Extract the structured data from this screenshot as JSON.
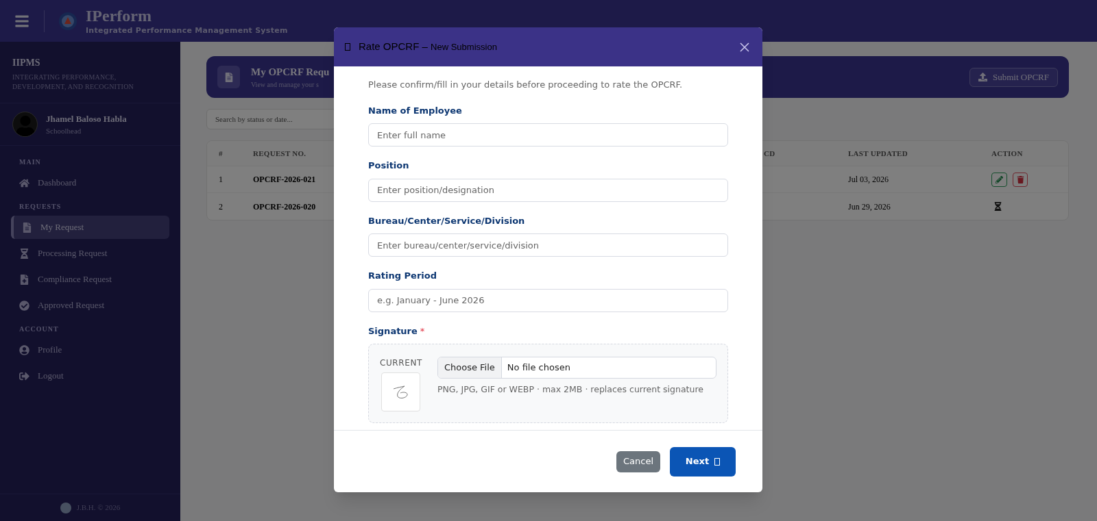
{
  "app_header": {
    "title": "IPerform",
    "subtitle": "Integrated Performance Management System"
  },
  "sidebar": {
    "brand": "IIPMS",
    "tagline": "INTEGRATING PERFORMANCE, DEVELOPMENT, AND RECOGNITION",
    "user": {
      "name": "Jhamel Baloso Habla",
      "role": "Schoolhead"
    },
    "sections": [
      {
        "title": "MAIN",
        "items": [
          {
            "label": "Dashboard",
            "selected": false
          }
        ]
      },
      {
        "title": "REQUESTS",
        "items": [
          {
            "label": "My Request",
            "selected": true
          },
          {
            "label": "Processing Request",
            "selected": false
          },
          {
            "label": "Compliance Request",
            "selected": false
          },
          {
            "label": "Approved Request",
            "selected": false
          }
        ]
      },
      {
        "title": "ACCOUNT",
        "items": [
          {
            "label": "Profile",
            "selected": false
          },
          {
            "label": "Logout",
            "selected": false
          }
        ]
      }
    ],
    "footer": "J.B.H. © 2026"
  },
  "page_header": {
    "title": "My OPCRF Requ",
    "subtitle": "View and manage your s",
    "button": "Submit OPCRF"
  },
  "search": {
    "placeholder": "Search by status or date..."
  },
  "table": {
    "columns": [
      "#",
      "REQUEST NO.",
      "CD",
      "LAST UPDATED",
      "ACTION"
    ],
    "rows": [
      {
        "number": "1",
        "request_no": "OPCRF-2026-021",
        "last_updated": "Jul 03, 2026",
        "kind": "editable"
      },
      {
        "number": "2",
        "request_no": "OPCRF-2026-020",
        "last_updated": "Jun 29, 2026",
        "kind": "pending"
      }
    ]
  },
  "modal": {
    "title": "Rate OPCRF –",
    "title_suffix": "New Submission",
    "intro": "Please confirm/fill in your details before proceeding to rate the OPCRF.",
    "fields": [
      {
        "label": "Name of Employee",
        "placeholder": "Enter full name"
      },
      {
        "label": "Position",
        "placeholder": "Enter position/designation"
      },
      {
        "label": "Bureau/Center/Service/Division",
        "placeholder": "Enter bureau/center/service/division"
      },
      {
        "label": "Rating Period",
        "placeholder": "e.g. January - June 2026"
      }
    ],
    "signature": {
      "label": "Signature",
      "required_mark": "*",
      "current_label": "CURRENT",
      "choose_button": "Choose File",
      "file_status": "No file chosen",
      "hint": "PNG, JPG, GIF or WEBP · max 2MB · replaces current signature"
    },
    "buttons": {
      "cancel": "Cancel",
      "next": "Next"
    }
  }
}
